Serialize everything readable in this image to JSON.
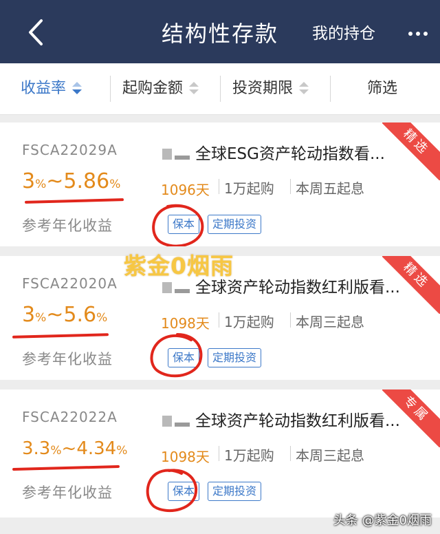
{
  "navbar": {
    "title": "结构性存款",
    "holdings": "我的持仓",
    "back_icon": "chevron-left-icon",
    "more_icon": "more-dots-icon"
  },
  "sortbar": {
    "items": [
      {
        "label": "收益率",
        "active": true
      },
      {
        "label": "起购金额",
        "active": false
      },
      {
        "label": "投资期限",
        "active": false
      }
    ],
    "filter": "筛选"
  },
  "colors": {
    "navbar": "#2b3a5c",
    "accent": "#3c78c8",
    "rate": "#e38a1b",
    "ribbon": "#ec4a44",
    "annotation": "#e1261c",
    "watermark": "#f7c743"
  },
  "products": [
    {
      "code": "FSCA22029A",
      "rate_min": "3",
      "rate_max": "5.86",
      "pct": "%",
      "tilde": "~",
      "rate_label": "参考年化收益",
      "name": "全球ESG资产轮动指数看...",
      "term": "1096天",
      "min_purchase": "1万起购",
      "start": "本周五起息",
      "tags": [
        "保本",
        "定期投资"
      ],
      "ribbon": "精选"
    },
    {
      "code": "FSCA22020A",
      "rate_min": "3",
      "rate_max": "5.6",
      "pct": "%",
      "tilde": "~",
      "rate_label": "参考年化收益",
      "name": "全球资产轮动指数红利版看...",
      "term": "1098天",
      "min_purchase": "1万起购",
      "start": "本周三起息",
      "tags": [
        "保本",
        "定期投资"
      ],
      "ribbon": "精选"
    },
    {
      "code": "FSCA22022A",
      "rate_min": "3.3",
      "rate_max": "4.34",
      "pct": "%",
      "tilde": "~",
      "rate_label": "参考年化收益",
      "name": "全球资产轮动指数红利版看...",
      "term": "1098天",
      "min_purchase": "1万起购",
      "start": "本周三起息",
      "tags": [
        "保本",
        "定期投资"
      ],
      "ribbon": "专属"
    }
  ],
  "watermark": "紫金0烟雨",
  "footer_credit": "头条 @紫金0烟雨"
}
